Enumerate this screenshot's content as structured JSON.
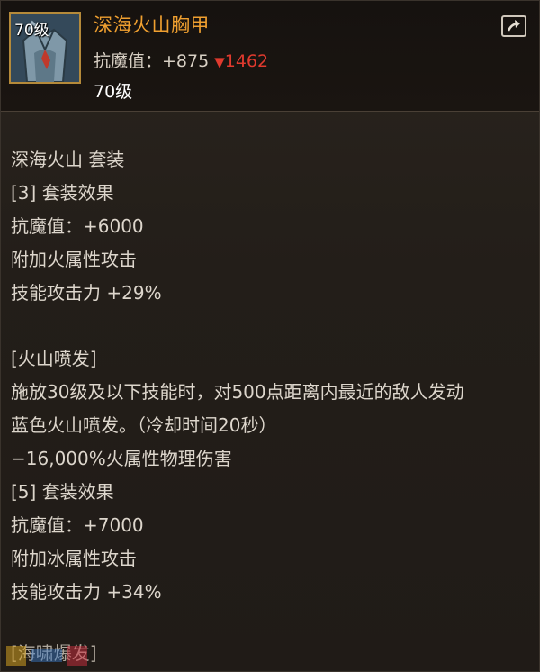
{
  "item": {
    "icon_level": "70级",
    "name": "深海火山胸甲",
    "stat_label": "抗魔值：",
    "stat_value": "+875",
    "stat_diff": "1462",
    "level": "70级",
    "name_color": "#f0a030",
    "diff_color": "#e03a2e"
  },
  "set": {
    "name": "深海火山  套装",
    "bonus3": {
      "title": "[3] 套装效果",
      "lines": [
        "抗魔值：+6000",
        "附加火属性攻击",
        "技能攻击力 +29%"
      ]
    },
    "effect": {
      "title": "[火山喷发]",
      "lines": [
        "施放30级及以下技能时，对500点距离内最近的敌人发动",
        "蓝色火山喷发。（冷却时间20秒）",
        "−16,000%火属性物理伤害"
      ]
    },
    "bonus5": {
      "title": "[5] 套装效果",
      "lines": [
        "抗魔值：+7000",
        "附加冰属性攻击",
        "技能攻击力 +34%"
      ]
    },
    "footer": "[海啸爆发]"
  },
  "icons": {
    "item": "chest-armor-icon",
    "share": "share-icon",
    "arrow": "down-arrow-icon"
  }
}
